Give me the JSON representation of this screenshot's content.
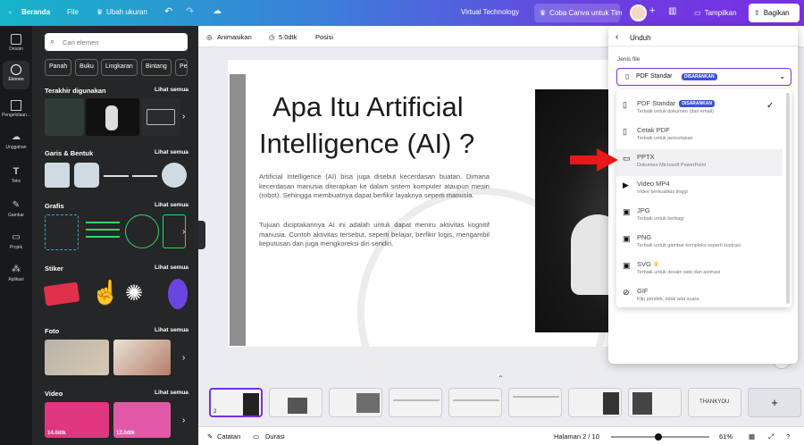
{
  "topbar": {
    "home": "Beranda",
    "file": "File",
    "resize": "Ubah ukuran",
    "doc_title": "Virtual Technology",
    "try_team": "Coba Canva untuk Tim",
    "present": "Tampilkan",
    "share": "Bagikan"
  },
  "rail": [
    {
      "label": "Desain",
      "icon": "layout-icon"
    },
    {
      "label": "Elemen",
      "icon": "elements-icon"
    },
    {
      "label": "Pengelolaan...",
      "icon": "brand-icon"
    },
    {
      "label": "Unggahan",
      "icon": "upload-icon"
    },
    {
      "label": "Teks",
      "icon": "text-icon"
    },
    {
      "label": "Gambar",
      "icon": "draw-icon"
    },
    {
      "label": "Projek",
      "icon": "folder-icon"
    },
    {
      "label": "Aplikasi",
      "icon": "apps-icon"
    }
  ],
  "panel": {
    "search_placeholder": "Cari elemen",
    "chips": [
      "Panah",
      "Buku",
      "Lingkaran",
      "Bintang",
      "Pe"
    ],
    "sections": [
      {
        "title": "Terakhir digunakan",
        "see_all": "Lihat semua"
      },
      {
        "title": "Garis & Bentuk",
        "see_all": "Lihat semua"
      },
      {
        "title": "Grafis",
        "see_all": "Lihat semua"
      },
      {
        "title": "Stiker",
        "see_all": "Lihat semua"
      },
      {
        "title": "Foto",
        "see_all": "Lihat semua"
      },
      {
        "title": "Video",
        "see_all": "Lihat semua"
      }
    ],
    "video_durations": [
      "14.0dtk",
      "12.0dtk"
    ]
  },
  "editor_toolbar": {
    "animate": "Animasikan",
    "duration": "5.0dtk",
    "position": "Posisi"
  },
  "slide": {
    "title_line1": "Apa Itu Artificial",
    "title_line2": "Intelligence (AI) ?",
    "para1": "Artificial Intelligence (AI) bisa juga disebut kecerdasan buatan. Dimana kecerdasan manusia diterapkan ke dalam sistem komputer ataupun mesin (robot). Sehingga membuatnya dapat berfikir layaknya seperti manusia.",
    "para2": "Tujuan diciptakannya AI ini adalah untuk dapat meniru aktivitas kognitif manusia. Contoh aktivitas tersebut, seperti belajar, berfikir logis, mengambil keputusan dan juga mengkoreksi diri sendiri."
  },
  "download": {
    "header": "Unduh",
    "file_type_label": "Jenis file",
    "selected": "PDF Standar",
    "selected_badge": "DISARANKAN",
    "options": [
      {
        "title": "PDF Standar",
        "badge": "DISARANKAN",
        "desc": "Terbaik untuk dokumen (dan email)",
        "icon": "file-icon",
        "checked": true
      },
      {
        "title": "Cetak PDF",
        "badge": "",
        "desc": "Terbaik untuk pencetakan",
        "icon": "file-icon",
        "checked": false
      },
      {
        "title": "PPTX",
        "badge": "",
        "desc": "Dokumen Microsoft PowerPoint",
        "icon": "presentation-icon",
        "checked": false
      },
      {
        "title": "Video MP4",
        "badge": "",
        "desc": "Video berkualitas tinggi",
        "icon": "video-icon",
        "checked": false
      },
      {
        "title": "JPG",
        "badge": "",
        "desc": "Terbaik untuk berbagi",
        "icon": "image-icon",
        "checked": false
      },
      {
        "title": "PNG",
        "badge": "",
        "desc": "Terbaik untuk gambar kompleks seperti ilustrasi",
        "icon": "image-icon",
        "checked": false
      },
      {
        "title": "SVG",
        "badge": "",
        "desc": "Terbaik untuk desain web dan animasi",
        "icon": "image-icon",
        "checked": false
      },
      {
        "title": "GIF",
        "badge": "",
        "desc": "Klip pendek, tidak ada suara",
        "icon": "gif-icon",
        "checked": false
      }
    ]
  },
  "filmstrip": {
    "current_page": "2",
    "slide8_text": "THANKYOU"
  },
  "bottombar": {
    "notes": "Catatan",
    "duration": "Durasi",
    "page": "Halaman 2 / 10",
    "zoom": "61%"
  },
  "colors": {
    "accent": "#7a2fe3",
    "arrow": "#e81818",
    "badge": "#3d52d5"
  }
}
